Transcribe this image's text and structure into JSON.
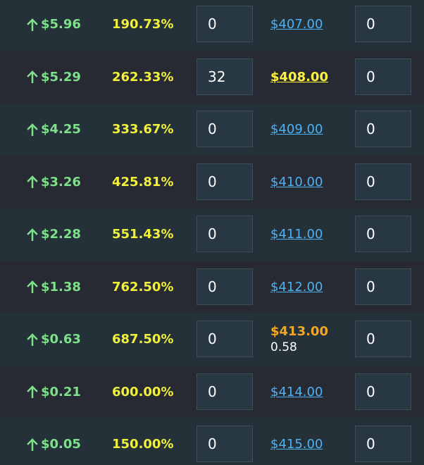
{
  "rows": [
    {
      "change": "$5.96",
      "percent": "190.73%",
      "buy_qty": "0",
      "price": "$407.00",
      "price_state": "link",
      "sub": "",
      "sell_qty": "0"
    },
    {
      "change": "$5.29",
      "percent": "262.33%",
      "buy_qty": "32",
      "price": "$408.00",
      "price_state": "active",
      "sub": "",
      "sell_qty": "0"
    },
    {
      "change": "$4.25",
      "percent": "333.67%",
      "buy_qty": "0",
      "price": "$409.00",
      "price_state": "link",
      "sub": "",
      "sell_qty": "0"
    },
    {
      "change": "$3.26",
      "percent": "425.81%",
      "buy_qty": "0",
      "price": "$410.00",
      "price_state": "link",
      "sub": "",
      "sell_qty": "0"
    },
    {
      "change": "$2.28",
      "percent": "551.43%",
      "buy_qty": "0",
      "price": "$411.00",
      "price_state": "link",
      "sub": "",
      "sell_qty": "0"
    },
    {
      "change": "$1.38",
      "percent": "762.50%",
      "buy_qty": "0",
      "price": "$412.00",
      "price_state": "link",
      "sub": "",
      "sell_qty": "0"
    },
    {
      "change": "$0.63",
      "percent": "687.50%",
      "buy_qty": "0",
      "price": "$413.00",
      "price_state": "warn",
      "sub": "0.58",
      "sell_qty": "0"
    },
    {
      "change": "$0.21",
      "percent": "600.00%",
      "buy_qty": "0",
      "price": "$414.00",
      "price_state": "link",
      "sub": "",
      "sell_qty": "0"
    },
    {
      "change": "$0.05",
      "percent": "150.00%",
      "buy_qty": "0",
      "price": "$415.00",
      "price_state": "link",
      "sub": "",
      "sell_qty": "0"
    }
  ],
  "icons": {
    "change_icon": "arrow-up-icon"
  },
  "colors": {
    "change": "#7ee08a",
    "percent": "#f1f13a",
    "price_link": "#4db2f2",
    "price_active": "#fff23d",
    "price_warn": "#f5a623",
    "row_bg_a": "#243139",
    "row_bg_b": "#272a33"
  }
}
